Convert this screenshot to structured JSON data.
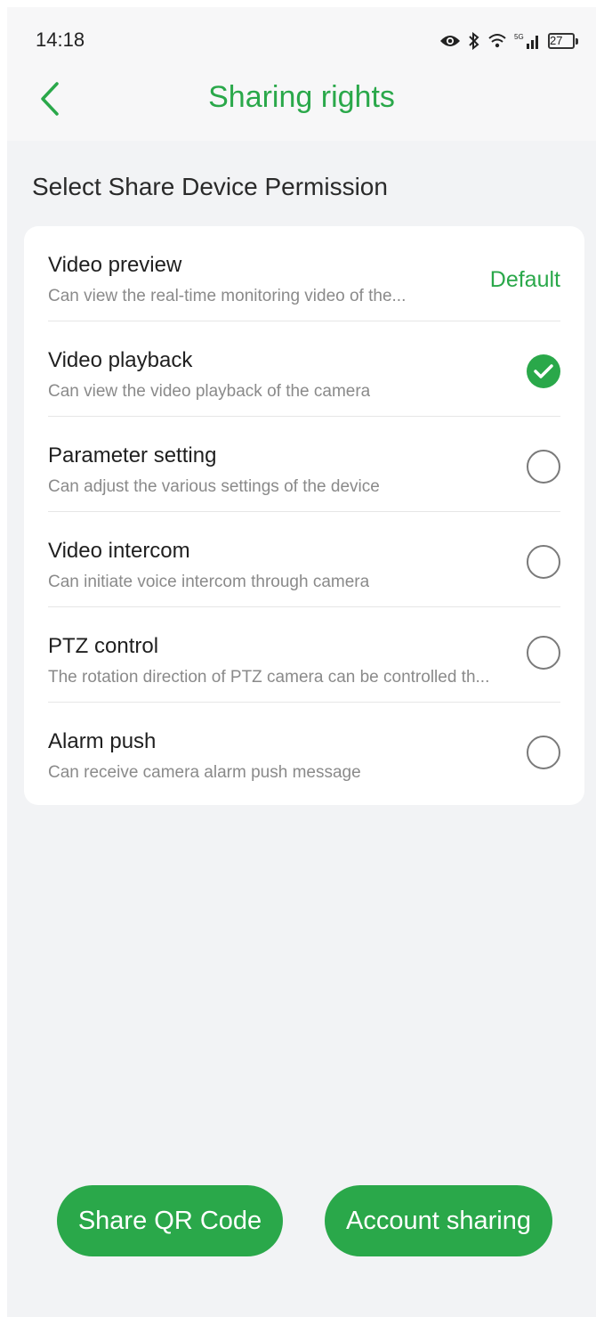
{
  "status_bar": {
    "time": "14:18",
    "battery": "27",
    "network": "5G"
  },
  "header": {
    "title": "Sharing rights",
    "back_icon": "chevron-left-icon"
  },
  "section_title": "Select Share Device Permission",
  "permissions": [
    {
      "title": "Video preview",
      "description": "Can view the real-time monitoring video of the...",
      "state": "default",
      "tag": "Default"
    },
    {
      "title": "Video playback",
      "description": "Can view the video playback of the camera",
      "state": "checked"
    },
    {
      "title": "Parameter setting",
      "description": "Can adjust the various settings of the device",
      "state": "unchecked"
    },
    {
      "title": "Video intercom",
      "description": "Can initiate voice intercom through camera",
      "state": "unchecked"
    },
    {
      "title": "PTZ control",
      "description": "The rotation direction of PTZ camera can be controlled th...",
      "state": "unchecked"
    },
    {
      "title": "Alarm push",
      "description": "Can receive camera alarm push message",
      "state": "unchecked"
    }
  ],
  "buttons": {
    "share_qr": "Share QR Code",
    "account_sharing": "Account sharing"
  },
  "colors": {
    "accent": "#2aa84a",
    "background": "#f2f3f5",
    "card": "#ffffff"
  }
}
